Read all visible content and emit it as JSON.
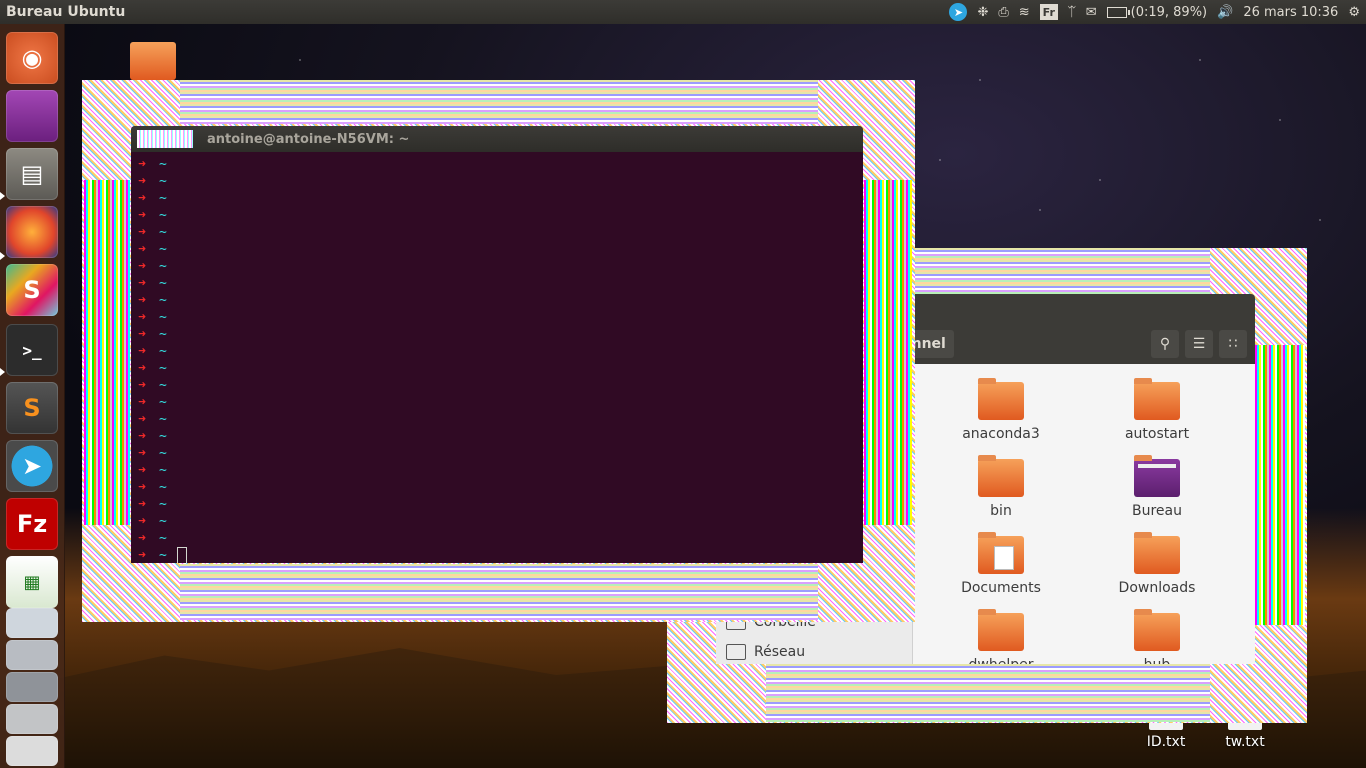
{
  "top_panel": {
    "title": "Bureau Ubuntu",
    "keyboard_layout": "Fr",
    "battery": "(0:19, 89%)",
    "datetime": "26 mars 10:36"
  },
  "launcher": {
    "items": [
      "ubuntu-dash",
      "workspace",
      "files",
      "firefox",
      "slack",
      "terminal",
      "sublime-text",
      "telegram",
      "filezilla",
      "libreoffice-calc",
      "scanner",
      "printer",
      "calculator",
      "disk",
      "stack"
    ]
  },
  "desktop": {
    "files": [
      {
        "label": "ID.txt"
      },
      {
        "label": "tw.txt"
      }
    ]
  },
  "terminal": {
    "title": "antoine@antoine-N56VM: ~",
    "prompt_arrow": "➜",
    "prompt_dir": "~"
  },
  "file_manager": {
    "breadcrumb": "onnel",
    "sidebar": {
      "trash": "Corbeille",
      "network": "Réseau"
    },
    "items": [
      {
        "label": "anaconda3"
      },
      {
        "label": "autostart"
      },
      {
        "label": "bin"
      },
      {
        "label": "Bureau"
      },
      {
        "label": "Documents"
      },
      {
        "label": "Downloads"
      },
      {
        "label": "dwhelper"
      },
      {
        "label": "hub"
      }
    ]
  }
}
